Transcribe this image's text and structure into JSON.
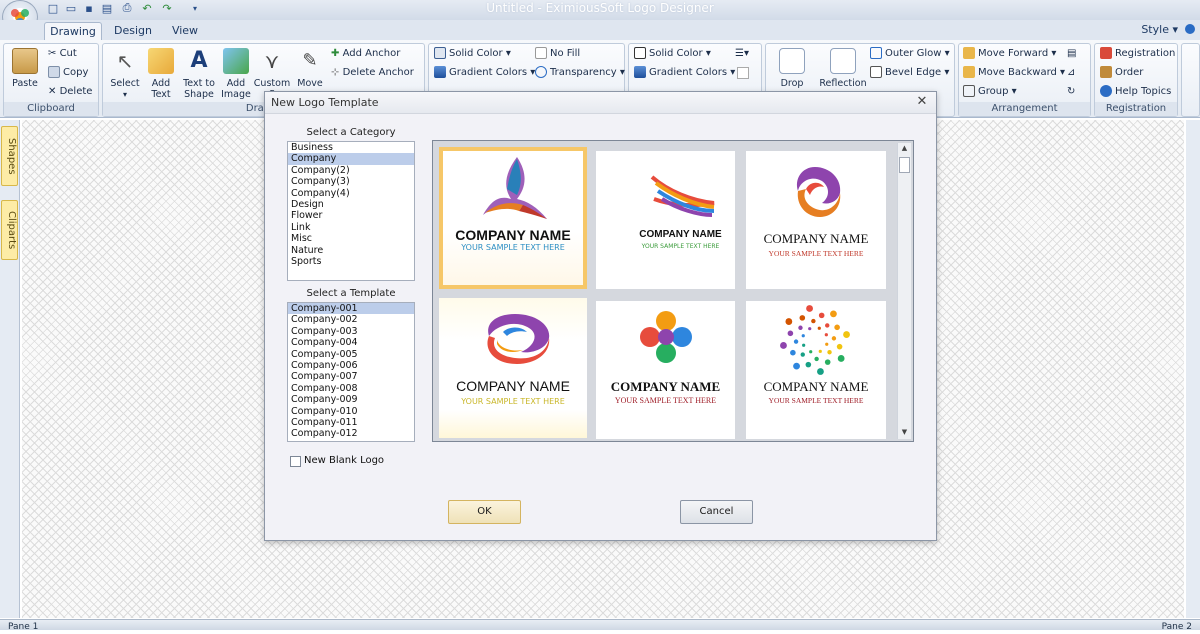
{
  "window": {
    "title": "Untitled - EximiousSoft Logo Designer",
    "style_menu": "Style"
  },
  "tabs": [
    {
      "label": "Drawing"
    },
    {
      "label": "Design"
    },
    {
      "label": "View"
    }
  ],
  "ribbon": {
    "clipboard": {
      "paste": "Paste",
      "cut": "Cut",
      "copy": "Copy",
      "delete": "Delete",
      "label": "Clipboard"
    },
    "drawing": {
      "select": "Select",
      "add_text": [
        "Add",
        "Text"
      ],
      "text_to_shape": [
        "Text to",
        "Shape"
      ],
      "add_image": [
        "Add",
        "Image"
      ],
      "custom": [
        "Custom",
        "S"
      ],
      "move": "Move",
      "add_anchor": "Add Anchor",
      "delete_anchor": "Delete Anchor",
      "label": "Drawin"
    },
    "fill": {
      "solid_color": "Solid Color",
      "no_fill": "No Fill",
      "gradient_colors": "Gradient Colors",
      "transparency": "Transparency"
    },
    "line": {
      "solid_color": "Solid Color",
      "gradient_colors": "Gradient Colors"
    },
    "effects": {
      "drop": "Drop",
      "reflection": "Reflection",
      "outer_glow": "Outer Glow",
      "bevel_edge": "Bevel Edge"
    },
    "arrangement": {
      "move_forward": "Move Forward",
      "move_backward": "Move Backward",
      "group": "Group",
      "label": "Arrangement"
    },
    "registration": {
      "registration": "Registration",
      "order": "Order",
      "help_topics": "Help Topics",
      "label": "Registration"
    }
  },
  "side_tabs": [
    "Shapes",
    "Cliparts"
  ],
  "status": {
    "left": "Pane 1",
    "right": "Pane 2"
  },
  "dialog": {
    "title": "New Logo Template",
    "close": "✕",
    "category_label": "Select a Category",
    "categories": [
      "Business",
      "Company",
      "Company(2)",
      "Company(3)",
      "Company(4)",
      "Design",
      "Flower",
      "Link",
      "Misc",
      "Nature",
      "Sports"
    ],
    "selected_category": "Company",
    "template_label": "Select a Template",
    "templates": [
      "Company-001",
      "Company-002",
      "Company-003",
      "Company-004",
      "Company-005",
      "Company-006",
      "Company-007",
      "Company-008",
      "Company-009",
      "Company-010",
      "Company-011",
      "Company-012"
    ],
    "selected_template": "Company-001",
    "thumbnails": [
      {
        "name": "COMPANY NAME",
        "tagline": "YOUR SAMPLE TEXT HERE",
        "tag_color": "#2d8fc4"
      },
      {
        "name": "COMPANY NAME",
        "tagline": "YOUR SAMPLE TEXT HERE",
        "tag_color": "#3a9b3a"
      },
      {
        "name": "COMPANY NAME",
        "tagline": "YOUR SAMPLE TEXT HERE",
        "tag_color": "#c0392b"
      },
      {
        "name": "COMPANY NAME",
        "tagline": "YOUR SAMPLE TEXT HERE",
        "tag_color": "#c9b72a"
      },
      {
        "name": "COMPANY NAME",
        "tagline": "YOUR SAMPLE TEXT HERE",
        "tag_color": "#a0202a"
      },
      {
        "name": "COMPANY NAME",
        "tagline": "YOUR SAMPLE TEXT HERE",
        "tag_color": "#a0202a"
      }
    ],
    "new_blank_logo": "New Blank Logo",
    "ok": "OK",
    "cancel": "Cancel"
  }
}
